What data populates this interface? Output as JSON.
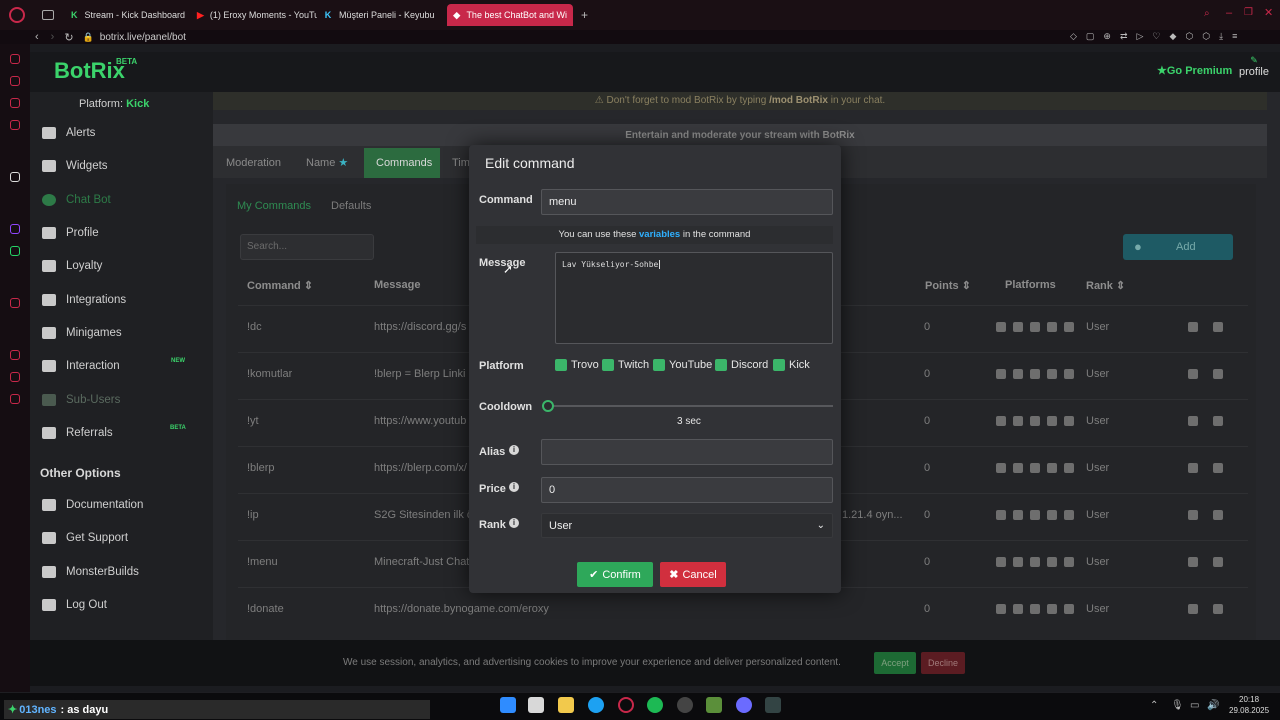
{
  "browser": {
    "tabs": [
      {
        "icon": "K",
        "label": "Stream - Kick Dashboard",
        "active": false
      },
      {
        "icon": "▶",
        "label": "(1) Eroxy Moments - YouTu",
        "active": false
      },
      {
        "icon": "K",
        "label": "Müşteri Paneli - Keyubu",
        "active": false
      },
      {
        "icon": "◆",
        "label": "The best ChatBot and Wi",
        "active": true
      }
    ],
    "new_tab": "+",
    "url": "botrix.live/panel/bot"
  },
  "app": {
    "logo": "BotRix",
    "logo_badge": "BETA",
    "go_premium": "Go Premium",
    "profile": "profile",
    "platform_label": "Platform:",
    "platform_value": "Kick",
    "notice_prefix": "Don't forget to mod BotRix by typing",
    "notice_command": "/mod BotRix",
    "notice_suffix": "in your chat.",
    "panel_title": "Entertain and moderate your stream with BotRix"
  },
  "sidebar": {
    "items": [
      {
        "label": "Alerts",
        "icon": "alert-triangle-icon"
      },
      {
        "label": "Widgets",
        "icon": "widgets-icon"
      },
      {
        "label": "Chat Bot",
        "icon": "chat-bot-icon"
      },
      {
        "label": "Profile",
        "icon": "profile-icon"
      },
      {
        "label": "Loyalty",
        "icon": "trophy-icon"
      },
      {
        "label": "Integrations",
        "icon": "integrations-icon"
      },
      {
        "label": "Minigames",
        "icon": "gamepad-icon"
      },
      {
        "label": "Interaction",
        "icon": "music-note-icon",
        "badge": "NEW"
      },
      {
        "label": "Sub-Users",
        "icon": "sub-users-icon"
      },
      {
        "label": "Referrals",
        "icon": "referrals-icon",
        "badge": "BETA"
      }
    ],
    "other_options_heading": "Other Options",
    "other_items": [
      {
        "label": "Documentation",
        "icon": "document-icon"
      },
      {
        "label": "Get Support",
        "icon": "support-icon"
      },
      {
        "label": "MonsterBuilds",
        "icon": "monitor-icon"
      },
      {
        "label": "Log Out",
        "icon": "logout-icon"
      }
    ]
  },
  "tabs": {
    "items": [
      "Moderation",
      "Name",
      "Commands",
      "Tim"
    ],
    "active": "Commands",
    "subtabs": [
      "My Commands",
      "Defaults"
    ]
  },
  "commands_table": {
    "search_placeholder": "Search...",
    "add_label": "Add",
    "headers": {
      "command": "Command",
      "message": "Message",
      "points": "Points",
      "platforms": "Platforms",
      "rank": "Rank"
    },
    "rows": [
      {
        "command": "!dc",
        "message": "https://discord.gg/s",
        "extra": "",
        "points": "0",
        "rank": "User"
      },
      {
        "command": "!komutlar",
        "message": "!blerp = Blerp Linki !",
        "extra": "",
        "points": "0",
        "rank": "User"
      },
      {
        "command": "!yt",
        "message": "https://www.youtub",
        "extra": "",
        "points": "0",
        "rank": "User"
      },
      {
        "command": "!blerp",
        "message": "https://blerp.com/x/",
        "extra": "",
        "points": "0",
        "rank": "User"
      },
      {
        "command": "!ip",
        "message": "S2G Sitesinden ilk ö",
        "extra": "1.21.4 oyn...",
        "points": "0",
        "rank": "User"
      },
      {
        "command": "!menu",
        "message": "Minecraft-Just Chatt",
        "extra": "",
        "points": "0",
        "rank": "User"
      },
      {
        "command": "!donate",
        "message": "https://donate.bynogame.com/eroxy",
        "extra": "",
        "points": "0",
        "rank": "User"
      }
    ]
  },
  "modal": {
    "title": "Edit command",
    "command_label": "Command",
    "command_value": "menu",
    "hint_prefix": "You can use these",
    "hint_link": "variables",
    "hint_suffix": "in the command",
    "message_label": "Message",
    "message_value": "Lav Yükseliyor-Sohbe",
    "platform_label": "Platform",
    "platforms": [
      "Trovo",
      "Twitch",
      "YouTube",
      "Discord",
      "Kick"
    ],
    "cooldown_label": "Cooldown",
    "cooldown_value": "3 sec",
    "alias_label": "Alias",
    "alias_value": "",
    "price_label": "Price",
    "price_value": "0",
    "rank_label": "Rank",
    "rank_value": "User",
    "confirm_label": "Confirm",
    "cancel_label": "Cancel"
  },
  "cookie": {
    "text": "We use session, analytics, and advertising cookies to improve your experience and deliver personalized content.",
    "accept": "Accept",
    "decline": "Decline"
  },
  "taskbar": {
    "chat_user": "013nes",
    "chat_text": ": as dayu",
    "time": "20:18",
    "date": "29.08.2025"
  },
  "colors": {
    "accent": "#3bd36b",
    "danger": "#d12f3e",
    "browser_accent": "#c8284a",
    "link": "#2fb0ff"
  }
}
